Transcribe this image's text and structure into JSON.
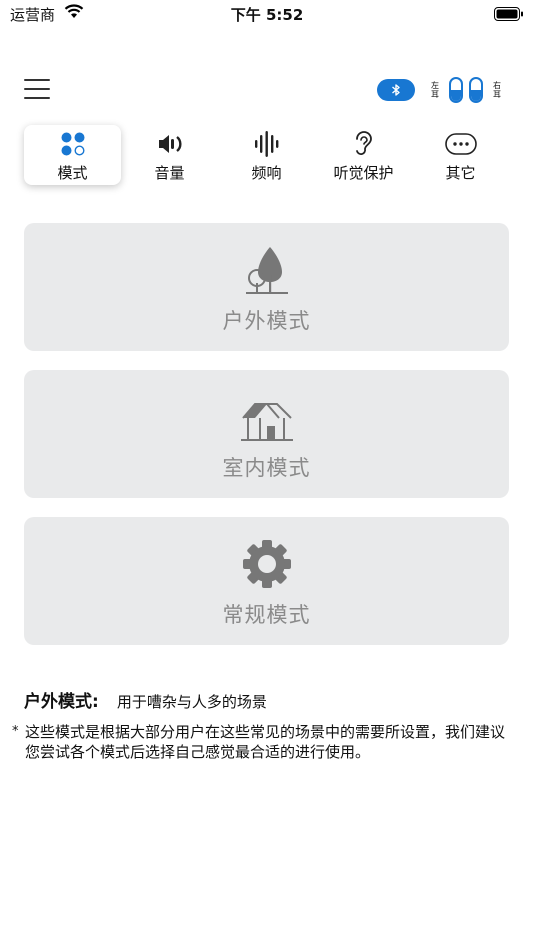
{
  "status_bar": {
    "carrier": "运营商",
    "time": "下午 5:52"
  },
  "header": {
    "menu_icon": "hamburger-icon",
    "bluetooth_icon": "bluetooth-icon",
    "left_ear_label": "左耳",
    "right_ear_label": "右耳",
    "left_battery_level": 0.5,
    "right_battery_level": 0.5
  },
  "tabs": [
    {
      "label": "模式",
      "icon": "mode-dots-icon",
      "active": true
    },
    {
      "label": "音量",
      "icon": "volume-icon",
      "active": false
    },
    {
      "label": "频响",
      "icon": "frequency-bars-icon",
      "active": false
    },
    {
      "label": "听觉保护",
      "icon": "ear-icon",
      "active": false
    },
    {
      "label": "其它",
      "icon": "more-dots-icon",
      "active": false
    }
  ],
  "modes": [
    {
      "label": "户外模式",
      "icon": "tree-icon"
    },
    {
      "label": "室内模式",
      "icon": "house-icon"
    },
    {
      "label": "常规模式",
      "icon": "gear-icon"
    }
  ],
  "description": {
    "title": "户外模式:",
    "text": "用于嘈杂与人多的场景"
  },
  "note": {
    "star": "*",
    "text": "这些模式是根据大部分用户在这些常见的场景中的需要所设置，我们建议您尝试各个模式后选择自己感觉最合适的进行使用。"
  },
  "colors": {
    "accent": "#1877d2",
    "card_bg": "#e9eaeb",
    "card_text": "#8a8a8a"
  }
}
